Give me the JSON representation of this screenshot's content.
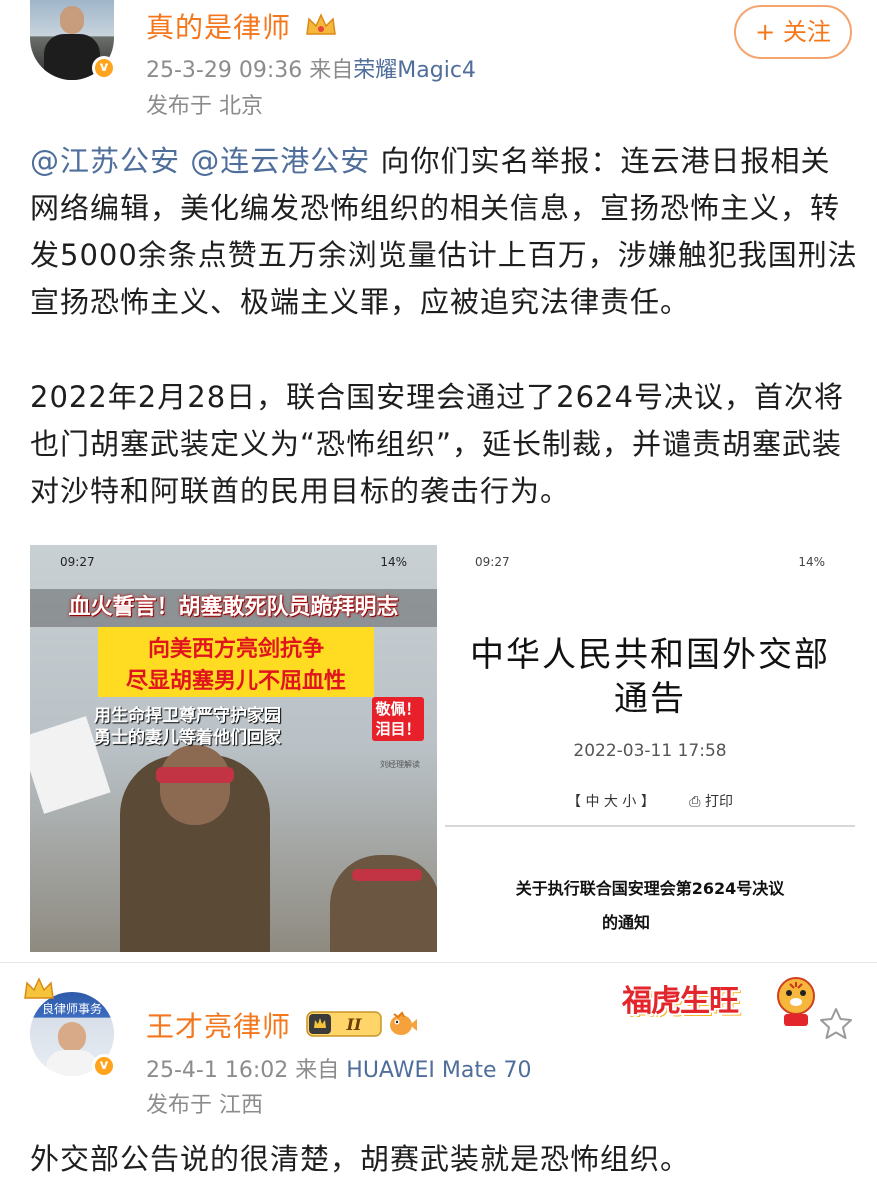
{
  "post1": {
    "author": "真的是律师",
    "follow_label": "+ 关注",
    "time": "25-3-29 09:36",
    "source_prefix": "来自",
    "source_device": "荣耀Magic4",
    "location": "发布于  北京",
    "mention1": "@江苏公安",
    "mention2": "@连云港公安",
    "text_para1": " 向你们实名举报：连云港日报相关网络编辑，美化编发恐怖组织的相关信息，宣扬恐怖主义，转发5000余条点赞五万余浏览量估计上百万，涉嫌触犯我国刑法宣扬恐怖主义、极端主义罪，应被追究法律责任。",
    "text_para2": "2022年2月28日，联合国安理会通过了2624号决议，首次将也门胡塞武装定义为“恐怖组织”，延长制裁，并谴责胡塞武装对沙特和阿联酋的民用目标的袭击行为。",
    "image_left": {
      "status_time": "09:27",
      "status_battery": "14%",
      "banner": "血火誓言！胡塞敢死队员跪拜明志",
      "yellow_line1": "向美西方亮剑抗争",
      "yellow_line2": "尽显胡塞男儿不屈血性",
      "sub_line1": "用生命捍卫尊严守护家园",
      "sub_line2": "勇士的妻儿等着他们回家",
      "tag": "敬佩！泪目！",
      "watermark": "刘经理解读"
    },
    "image_right": {
      "status_time": "09:27",
      "status_battery": "14%",
      "title_line1": "中华人民共和国外交部",
      "title_line2": "通告",
      "date": "2022-03-11 17:58",
      "font_size_tools": "【 中  大  小 】",
      "print_label": "打印",
      "heading_line1": "关于执行联合国安理会第2624号决议",
      "heading_line2": "的通知"
    }
  },
  "post2": {
    "author": "王才亮律师",
    "level": "II",
    "time": "25-4-1 16:02",
    "source_prefix": "来自",
    "source_device": "HUAWEI Mate 70",
    "location": "发布于  江西",
    "avatar_banner": "良律师事务",
    "sticker": "福虎生旺",
    "text": "外交部公告说的很清楚，胡赛武装就是恐怖组织。"
  },
  "colors": {
    "name_orange": "#f5771d",
    "link_blue": "#4f6e9b",
    "meta_gray": "#8c8c8c",
    "verified_badge": "#ffa41c"
  },
  "icons": [
    "crown-icon",
    "verified-icon",
    "level-badge-icon",
    "fish-icon",
    "tiger-sticker-icon",
    "star-icon",
    "print-icon"
  ]
}
